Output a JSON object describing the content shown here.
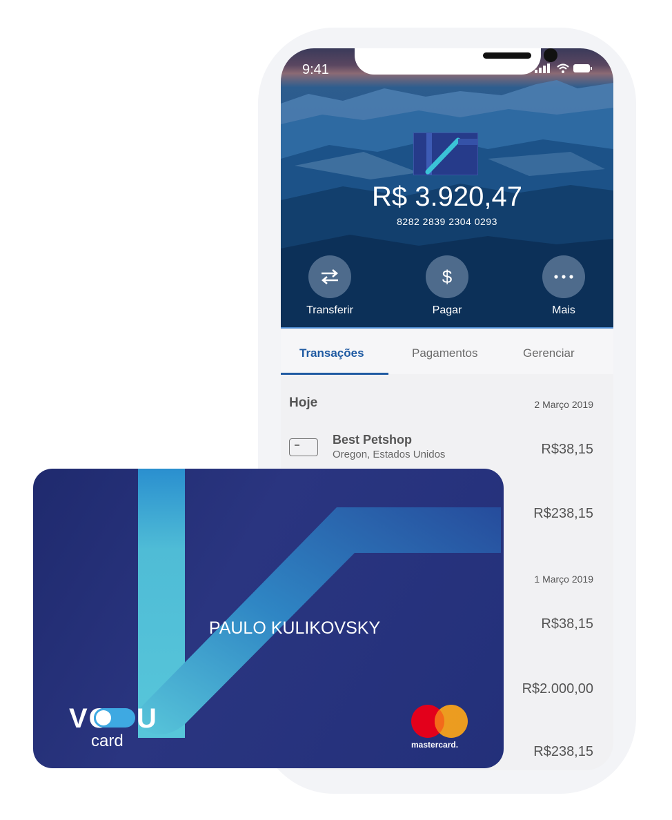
{
  "status_bar": {
    "time": "9:41"
  },
  "account": {
    "balance": "R$ 3.920,47",
    "card_number": "8282 2839 2304 0293"
  },
  "actions": [
    {
      "label": "Transferir",
      "icon": "transfer-arrows-icon"
    },
    {
      "label": "Pagar",
      "icon": "dollar-icon"
    },
    {
      "label": "Mais",
      "icon": "more-dots-icon"
    }
  ],
  "tabs": [
    {
      "label": "Transações",
      "active": true
    },
    {
      "label": "Pagamentos",
      "active": false
    },
    {
      "label": "Gerenciar",
      "active": false
    }
  ],
  "transactions": {
    "section_title": "Hoje",
    "date_today": "2 Março 2019",
    "date_yesterday": "1 Março 2019",
    "items": [
      {
        "name": "Best Petshop",
        "location": "Oregon, Estados Unidos",
        "amount": "R$38,15"
      },
      {
        "amount": "R$238,15"
      },
      {
        "amount": "R$38,15"
      },
      {
        "amount": "R$2.000,00"
      },
      {
        "amount": "R$238,15"
      }
    ]
  },
  "card": {
    "holder": "PAULO KULIKOVSKY",
    "brand_left": "VO",
    "brand_right": "U",
    "brand_sub": "card",
    "network": "mastercard."
  },
  "colors": {
    "accent": "#1f5aa2",
    "card_bg": "#2a3580",
    "card_stripe": "#4fbcd6",
    "mc_red": "#e3001b",
    "mc_orange": "#f7a21b"
  }
}
